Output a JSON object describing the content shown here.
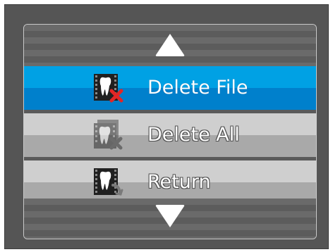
{
  "menu": {
    "items": [
      {
        "label": "Delete File",
        "icon": "tooth-delete-icon",
        "state": "selected"
      },
      {
        "label": "Delete All",
        "icon": "tooth-delete-all-icon",
        "state": "disabled"
      },
      {
        "label": "Return",
        "icon": "tooth-return-icon",
        "state": "normal"
      }
    ]
  },
  "colors": {
    "frame": "#555555",
    "selected_top": "#00a1e4",
    "selected_bottom": "#0080cc",
    "item_top": "#cfcfcf",
    "item_bottom": "#a9a9a9",
    "delete_x": "#e22626"
  }
}
